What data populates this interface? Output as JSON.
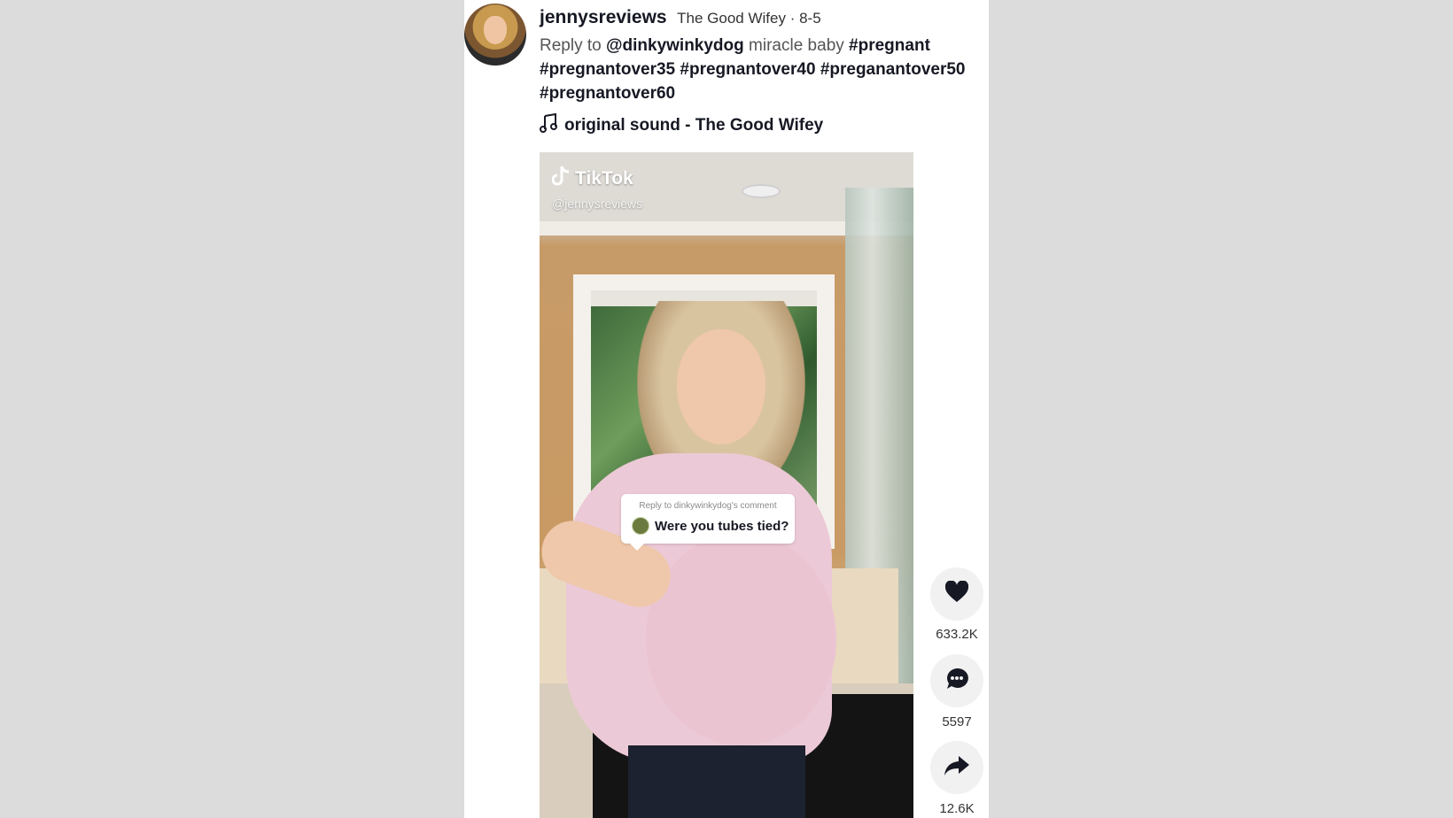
{
  "post": {
    "username": "jennysreviews",
    "nickname_date": "The Good Wifey · 8-5",
    "caption": {
      "reply_prefix": "Reply to ",
      "mention": "@dinkywinkydog",
      "text": " miracle baby ",
      "hashtags": [
        "#pregnant",
        "#pregnantover35",
        "#pregnantover40",
        "#preganantover50",
        "#pregnantover60"
      ]
    },
    "music": "original sound - The Good Wifey"
  },
  "video": {
    "watermark_brand": "TikTok",
    "watermark_handle": "@jennysreviews",
    "reply_header": "Reply to dinkywinkydog's comment",
    "reply_comment": "Were you tubes tied?"
  },
  "actions": {
    "likes": "633.2K",
    "comments": "5597",
    "shares": "12.6K"
  },
  "icons": [
    "music-note-icon",
    "tiktok-logo-icon",
    "heart-icon",
    "comment-icon",
    "share-icon"
  ]
}
